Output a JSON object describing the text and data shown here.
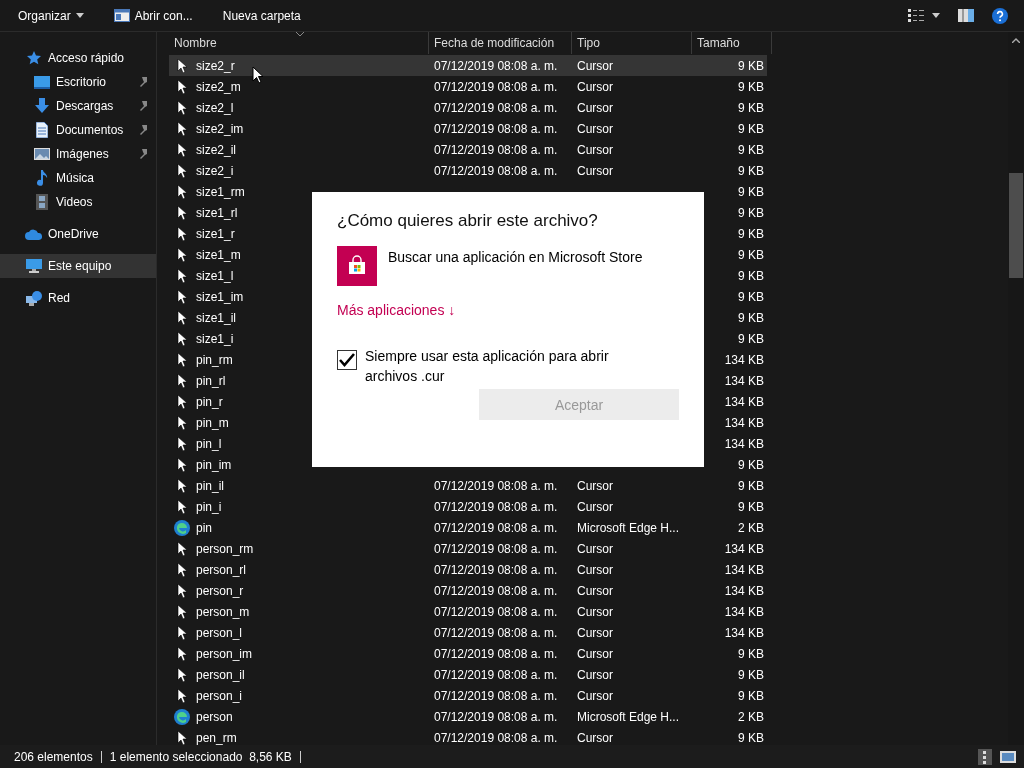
{
  "toolbar": {
    "items": [
      {
        "label": "Organizar",
        "kind": "menu"
      },
      {
        "label": "Abrir con...",
        "kind": "open"
      },
      {
        "label": "Nueva carpeta",
        "kind": "plain"
      }
    ]
  },
  "sidebar": {
    "items": [
      {
        "label": "Acceso rápido",
        "selected": false,
        "children": [
          {
            "label": "Escritorio",
            "pinned": true,
            "selected": false
          },
          {
            "label": "Descargas",
            "pinned": true,
            "selected": false
          },
          {
            "label": "Documentos",
            "pinned": true,
            "selected": false
          },
          {
            "label": "Imágenes",
            "pinned": true,
            "selected": false
          },
          {
            "label": "Música",
            "pinned": false,
            "selected": false
          },
          {
            "label": "Videos",
            "pinned": false,
            "selected": false
          }
        ]
      },
      {
        "label": "OneDrive",
        "selected": false
      },
      {
        "label": "Este equipo",
        "selected": true
      },
      {
        "label": "Red",
        "selected": false
      }
    ]
  },
  "file_list": {
    "columns": [
      "Nombre",
      "Fecha de modificación",
      "Tipo",
      "Tamaño"
    ],
    "rows": [
      {
        "name": "size2_r",
        "modified": "07/12/2019 08:08 a. m.",
        "type": "Cursor",
        "size": "9 KB",
        "kind": "cursor",
        "selected": true
      },
      {
        "name": "size2_m",
        "modified": "07/12/2019 08:08 a. m.",
        "type": "Cursor",
        "size": "9 KB",
        "kind": "cursor",
        "selected": false
      },
      {
        "name": "size2_l",
        "modified": "07/12/2019 08:08 a. m.",
        "type": "Cursor",
        "size": "9 KB",
        "kind": "cursor",
        "selected": false
      },
      {
        "name": "size2_im",
        "modified": "07/12/2019 08:08 a. m.",
        "type": "Cursor",
        "size": "9 KB",
        "kind": "cursor",
        "selected": false
      },
      {
        "name": "size2_il",
        "modified": "07/12/2019 08:08 a. m.",
        "type": "Cursor",
        "size": "9 KB",
        "kind": "cursor",
        "selected": false
      },
      {
        "name": "size2_i",
        "modified": "07/12/2019 08:08 a. m.",
        "type": "Cursor",
        "size": "9 KB",
        "kind": "cursor",
        "selected": false
      },
      {
        "name": "size1_rm",
        "size": "9 KB",
        "kind": "cursor",
        "selected": false
      },
      {
        "name": "size1_rl",
        "size": "9 KB",
        "kind": "cursor",
        "selected": false
      },
      {
        "name": "size1_r",
        "size": "9 KB",
        "kind": "cursor",
        "selected": false
      },
      {
        "name": "size1_m",
        "size": "9 KB",
        "kind": "cursor",
        "selected": false
      },
      {
        "name": "size1_l",
        "size": "9 KB",
        "kind": "cursor",
        "selected": false
      },
      {
        "name": "size1_im",
        "size": "9 KB",
        "kind": "cursor",
        "selected": false
      },
      {
        "name": "size1_il",
        "size": "9 KB",
        "kind": "cursor",
        "selected": false
      },
      {
        "name": "size1_i",
        "size": "9 KB",
        "kind": "cursor",
        "selected": false
      },
      {
        "name": "pin_rm",
        "size": "134 KB",
        "kind": "cursor",
        "selected": false
      },
      {
        "name": "pin_rl",
        "size": "134 KB",
        "kind": "cursor",
        "selected": false
      },
      {
        "name": "pin_r",
        "size": "134 KB",
        "kind": "cursor",
        "selected": false
      },
      {
        "name": "pin_m",
        "size": "134 KB",
        "kind": "cursor",
        "selected": false
      },
      {
        "name": "pin_l",
        "size": "134 KB",
        "kind": "cursor",
        "selected": false
      },
      {
        "name": "pin_im",
        "size": "9 KB",
        "kind": "cursor",
        "selected": false
      },
      {
        "name": "pin_il",
        "modified": "07/12/2019 08:08 a. m.",
        "type": "Cursor",
        "size": "9 KB",
        "kind": "cursor",
        "selected": false
      },
      {
        "name": "pin_i",
        "modified": "07/12/2019 08:08 a. m.",
        "type": "Cursor",
        "size": "9 KB",
        "kind": "cursor",
        "selected": false
      },
      {
        "name": "pin",
        "modified": "07/12/2019 08:08 a. m.",
        "type": "Microsoft Edge H...",
        "size": "2 KB",
        "kind": "edge",
        "selected": false
      },
      {
        "name": "person_rm",
        "modified": "07/12/2019 08:08 a. m.",
        "type": "Cursor",
        "size": "134 KB",
        "kind": "cursor",
        "selected": false
      },
      {
        "name": "person_rl",
        "modified": "07/12/2019 08:08 a. m.",
        "type": "Cursor",
        "size": "134 KB",
        "kind": "cursor",
        "selected": false
      },
      {
        "name": "person_r",
        "modified": "07/12/2019 08:08 a. m.",
        "type": "Cursor",
        "size": "134 KB",
        "kind": "cursor",
        "selected": false
      },
      {
        "name": "person_m",
        "modified": "07/12/2019 08:08 a. m.",
        "type": "Cursor",
        "size": "134 KB",
        "kind": "cursor",
        "selected": false
      },
      {
        "name": "person_l",
        "modified": "07/12/2019 08:08 a. m.",
        "type": "Cursor",
        "size": "134 KB",
        "kind": "cursor",
        "selected": false
      },
      {
        "name": "person_im",
        "modified": "07/12/2019 08:08 a. m.",
        "type": "Cursor",
        "size": "9 KB",
        "kind": "cursor",
        "selected": false
      },
      {
        "name": "person_il",
        "modified": "07/12/2019 08:08 a. m.",
        "type": "Cursor",
        "size": "9 KB",
        "kind": "cursor",
        "selected": false
      },
      {
        "name": "person_i",
        "modified": "07/12/2019 08:08 a. m.",
        "type": "Cursor",
        "size": "9 KB",
        "kind": "cursor",
        "selected": false
      },
      {
        "name": "person",
        "modified": "07/12/2019 08:08 a. m.",
        "type": "Microsoft Edge H...",
        "size": "2 KB",
        "kind": "edge",
        "selected": false
      },
      {
        "name": "pen_rm",
        "modified": "07/12/2019 08:08 a. m.",
        "type": "Cursor",
        "size": "9 KB",
        "kind": "cursor",
        "selected": false
      }
    ]
  },
  "dialog": {
    "title": "¿Cómo quieres abrir este archivo?",
    "store_option": "Buscar una aplicación en Microsoft Store",
    "more_link": "Más aplicaciones ↓",
    "always_use": {
      "label": "Siempre usar esta aplicación para abrir archivos .cur",
      "checked": true
    },
    "button": {
      "label": "Aceptar",
      "disabled": true
    }
  },
  "status_bar": {
    "count": "206 elementos",
    "selection": "1 elemento seleccionado  8,56 KB"
  }
}
